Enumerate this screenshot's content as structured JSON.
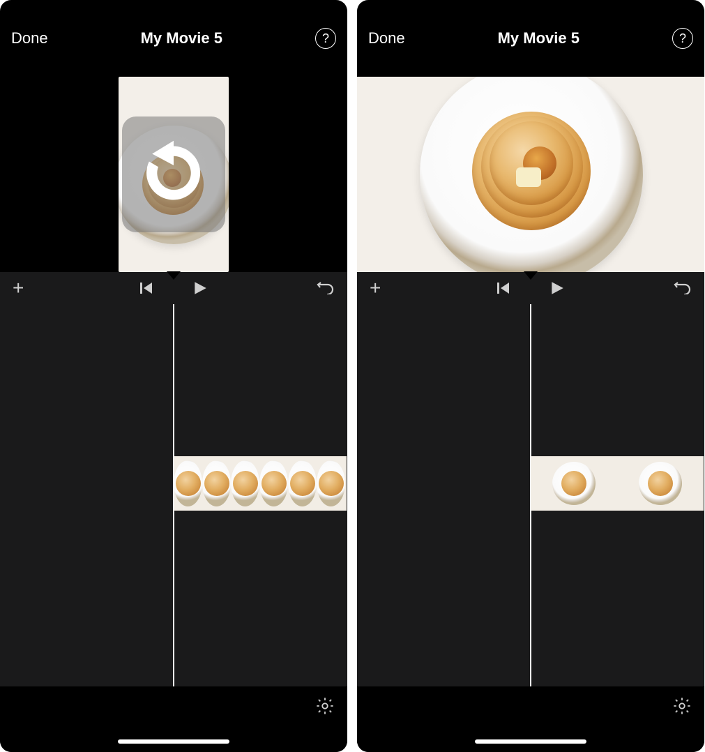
{
  "left": {
    "topbar": {
      "done": "Done",
      "title": "My Movie 5",
      "help": "?"
    },
    "overlay_icon": "rotate-ccw-icon",
    "thumb_count": 6
  },
  "right": {
    "topbar": {
      "done": "Done",
      "title": "My Movie 5",
      "help": "?"
    },
    "thumb_count": 2
  }
}
